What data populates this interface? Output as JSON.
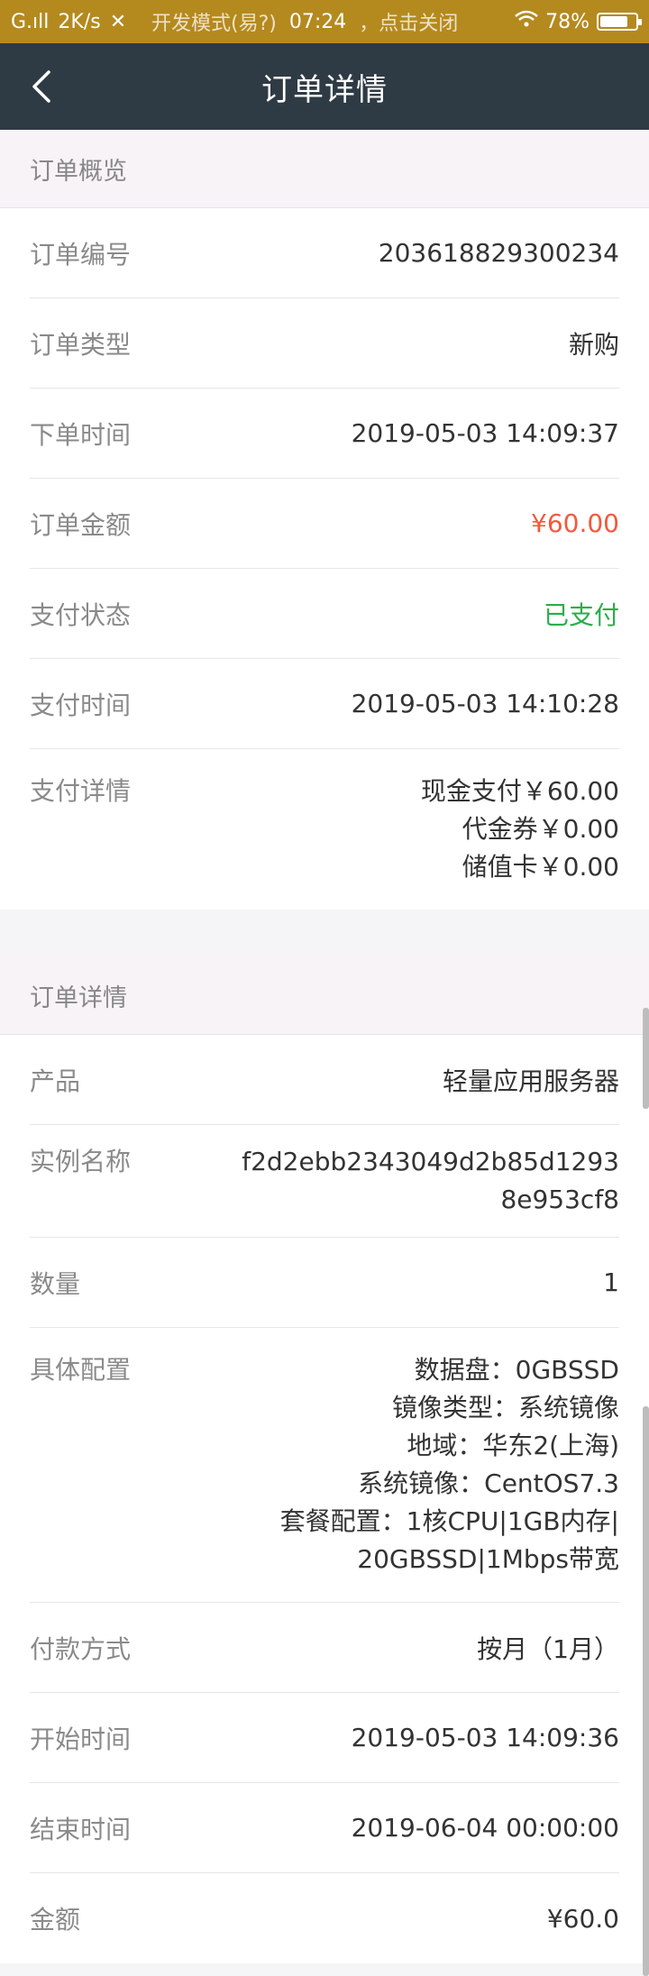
{
  "status_bar": {
    "signal": "G.ıll",
    "speed": "2K/s",
    "notice": "开发模式(易?)",
    "time": "07:24",
    "notice_tail": "，点击关闭",
    "battery": "78%",
    "battery_level": 0.78
  },
  "nav": {
    "title": "订单详情"
  },
  "overview": {
    "header": "订单概览",
    "rows": [
      {
        "label": "订单编号",
        "value": "203618829300234"
      },
      {
        "label": "订单类型",
        "value": "新购"
      },
      {
        "label": "下单时间",
        "value": "2019-05-03 14:09:37"
      },
      {
        "label": "订单金额",
        "value": "¥60.00"
      },
      {
        "label": "支付状态",
        "value": "已支付"
      },
      {
        "label": "支付时间",
        "value": "2019-05-03 14:10:28"
      },
      {
        "label": "支付详情",
        "lines": [
          "现金支付￥60.00",
          "代金券￥0.00",
          "储值卡￥0.00"
        ]
      }
    ]
  },
  "details": {
    "header": "订单详情",
    "rows": [
      {
        "label": "产品",
        "value": "轻量应用服务器"
      },
      {
        "label": "实例名称",
        "lines": [
          "f2d2ebb2343049d2b85d1293",
          "8e953cf8"
        ]
      },
      {
        "label": "数量",
        "value": "1"
      },
      {
        "label": "具体配置",
        "lines": [
          "数据盘：0GBSSD",
          "镜像类型：系统镜像",
          "地域：华东2(上海)",
          "系统镜像：CentOS7.3",
          "套餐配置：1核CPU|1GB内存|",
          "20GBSSD|1Mbps带宽"
        ]
      },
      {
        "label": "付款方式",
        "value": "按月（1月）"
      },
      {
        "label": "开始时间",
        "value": "2019-05-03 14:09:36"
      },
      {
        "label": "结束时间",
        "value": "2019-06-04 00:00:00"
      },
      {
        "label": "金额",
        "value": "¥60.0"
      }
    ]
  }
}
